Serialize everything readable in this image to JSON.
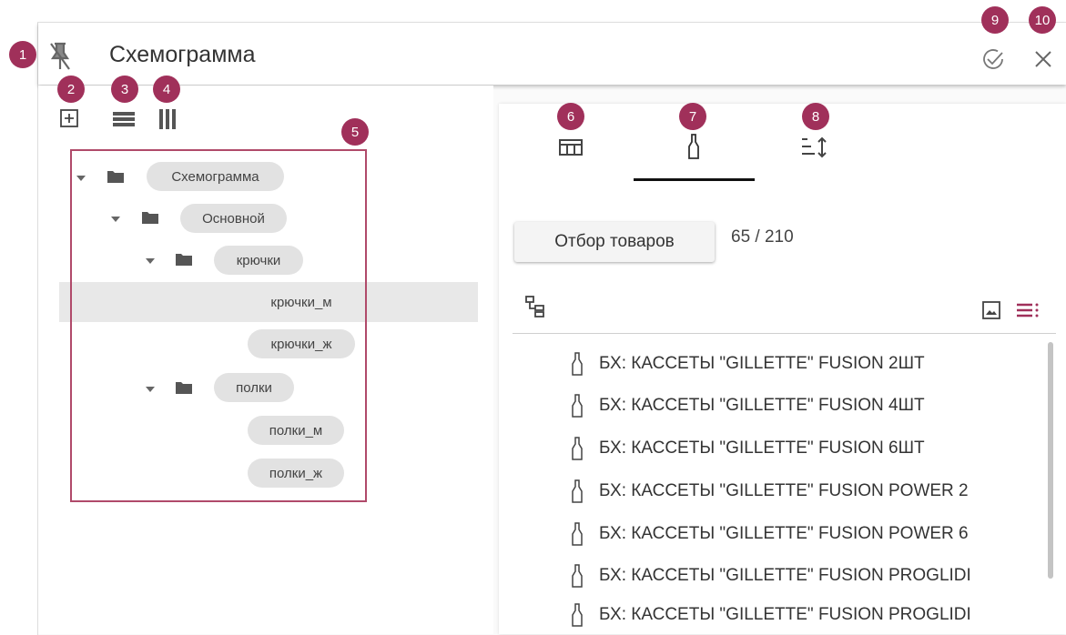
{
  "window": {
    "title": "Схемограмма"
  },
  "badges": [
    "1",
    "2",
    "3",
    "4",
    "5",
    "6",
    "7",
    "8",
    "9",
    "10"
  ],
  "toolbar": {
    "icons": [
      "unpin-icon",
      "add-icon",
      "rows-icon",
      "columns-icon"
    ]
  },
  "tree": {
    "nodes": [
      {
        "label": "Схемограмма",
        "level": 0,
        "type": "folder",
        "expanded": true
      },
      {
        "label": "Основной",
        "level": 1,
        "type": "folder",
        "expanded": true
      },
      {
        "label": "крючки",
        "level": 2,
        "type": "folder",
        "expanded": true
      },
      {
        "label": "крючки_м",
        "level": 3,
        "type": "leaf",
        "selected": true
      },
      {
        "label": "крючки_ж",
        "level": 3,
        "type": "leaf"
      },
      {
        "label": "полки",
        "level": 2,
        "type": "folder",
        "expanded": true
      },
      {
        "label": "полки_м",
        "level": 3,
        "type": "leaf"
      },
      {
        "label": "полки_ж",
        "level": 3,
        "type": "leaf"
      }
    ]
  },
  "tabs": [
    {
      "icon": "table-icon",
      "active": false
    },
    {
      "icon": "bottle-icon",
      "active": true
    },
    {
      "icon": "sort-icon",
      "active": false
    }
  ],
  "products": {
    "select_button": "Отбор товаров",
    "count": "65 / 210",
    "items": [
      "БХ: КАССЕТЫ \"GILLETTE\" FUSION 2ШТ",
      "БХ: КАССЕТЫ \"GILLETTE\" FUSION 4ШТ",
      "БХ: КАССЕТЫ \"GILLETTE\" FUSION 6ШТ",
      "БХ: КАССЕТЫ \"GILLETTE\" FUSION POWER 2",
      "БХ: КАССЕТЫ \"GILLETTE\" FUSION POWER 6",
      "БХ: КАССЕТЫ \"GILLETTE\" FUSION PROGLIDI",
      "БХ: КАССЕТЫ \"GILLETTE\" FUSION PROGLIDI"
    ]
  },
  "colors": {
    "badge": "#a0305a",
    "accent": "#a0305a",
    "selected_row": "#e8e8e8"
  }
}
